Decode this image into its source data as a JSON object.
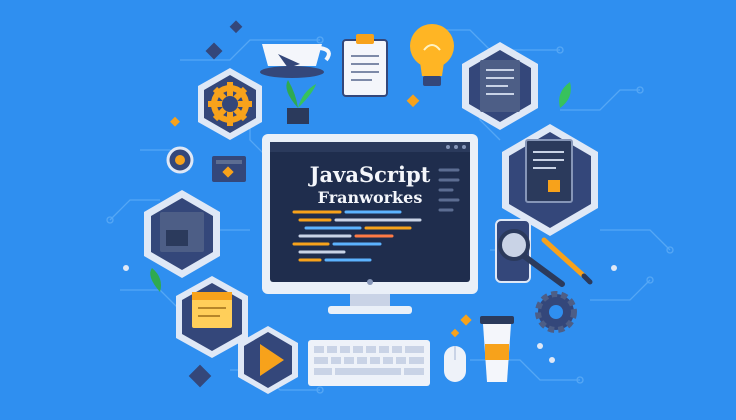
{
  "screen": {
    "title_line_1": "JavaScript",
    "title_line_2": "Franworkes"
  },
  "colors": {
    "background": "#2f8ff0",
    "accent_orange": "#f7a21b",
    "dark_navy": "#2b3a5c",
    "screen_bg": "#1f2d4d",
    "hexagon_outline": "#f0f4fb"
  },
  "icons": [
    "gear-icon",
    "coffee-cup-icon",
    "clipboard-icon",
    "lightbulb-icon",
    "plant-icon",
    "document-icon",
    "magnifier-icon",
    "phone-icon",
    "pencil-icon",
    "sticky-note-icon",
    "play-icon",
    "keyboard-icon",
    "mouse-icon",
    "coffee-tumbler-icon",
    "settings-cog-icon",
    "monitor-icon"
  ]
}
